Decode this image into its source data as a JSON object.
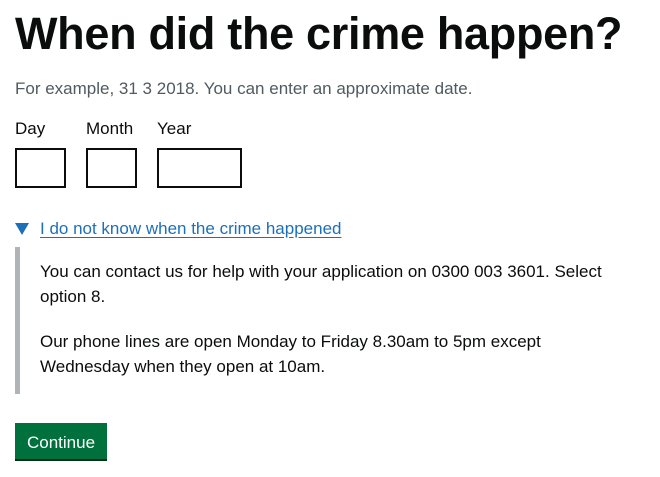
{
  "question": {
    "title": "When did the crime happen?",
    "hint": "For example, 31 3 2018. You can enter an approximate date."
  },
  "date_inputs": {
    "day_label": "Day",
    "month_label": "Month",
    "year_label": "Year",
    "day_value": "",
    "month_value": "",
    "year_value": ""
  },
  "details": {
    "summary": "I do not know when the crime happened",
    "paragraph_1": "You can contact us for help with your application on 0300 003 3601. Select option 8.",
    "paragraph_2": "Our phone lines are open Monday to Friday 8.30am to 5pm except Wednesday when they open at 10am."
  },
  "actions": {
    "continue_label": "Continue"
  },
  "colors": {
    "text": "#0b0c0c",
    "hint": "#505a5f",
    "link": "#1d70b8",
    "panel_border": "#b1b4b6",
    "button": "#00703c"
  }
}
